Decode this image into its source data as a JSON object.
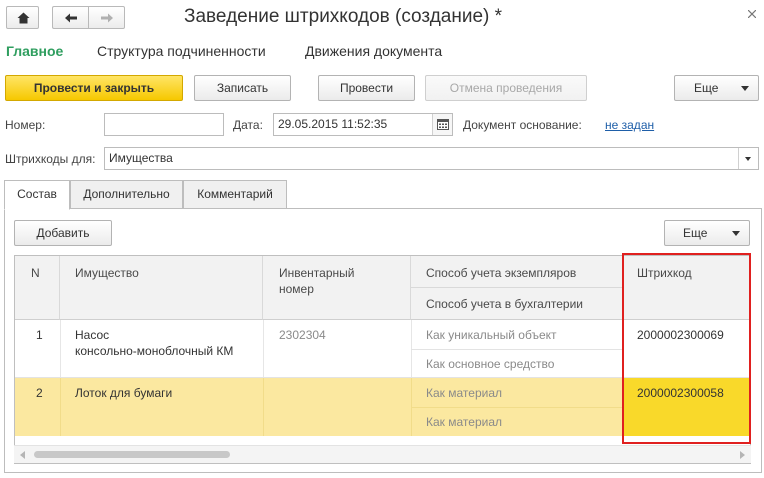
{
  "window": {
    "title": "Заведение штрихкодов (создание) *"
  },
  "nav": {
    "home_icon": "home-icon",
    "back_icon": "arrow-left-icon",
    "forward_icon": "arrow-right-icon"
  },
  "sections": {
    "main": "Главное",
    "structure": "Структура подчиненности",
    "movements": "Движения документа"
  },
  "toolbar": {
    "post_close": "Провести и закрыть",
    "save": "Записать",
    "post": "Провести",
    "unpost": "Отмена проведения",
    "more": "Еще"
  },
  "form": {
    "number_label": "Номер:",
    "number_value": "",
    "date_label": "Дата:",
    "date_value": "29.05.2015 11:52:35",
    "basis_label": "Документ основание:",
    "basis_link": "не задан",
    "barcodes_for_label": "Штрихкоды для:",
    "barcodes_for_value": "Имущества"
  },
  "tabs": {
    "composition": "Состав",
    "additional": "Дополнительно",
    "comment": "Комментарий"
  },
  "table_toolbar": {
    "add": "Добавить",
    "more": "Еще"
  },
  "table": {
    "headers": {
      "n": "N",
      "property": "Имущество",
      "inventory_line1": "Инвентарный",
      "inventory_line2": "номер",
      "instance_method": "Способ учета экземпляров",
      "accounting_method": "Способ учета в бухгалтерии",
      "barcode": "Штрихкод"
    },
    "rows": [
      {
        "n": "1",
        "property_line1": "Насос",
        "property_line2": "консольно-моноблочный КМ",
        "inventory": "2302304",
        "instance_method": "Как уникальный объект",
        "accounting_method": "Как основное средство",
        "barcode": "2000002300069"
      },
      {
        "n": "2",
        "property_line1": "Лоток для бумаги",
        "inventory": "",
        "instance_method": "Как материал",
        "accounting_method": "Как материал",
        "barcode": "2000002300058"
      }
    ]
  },
  "colors": {
    "accent_green": "#2f9e5f",
    "primary_button": "#f6c800",
    "selected_row": "#fbe8a0",
    "selected_cell": "#f9d92a",
    "highlight_outline": "#e0201f",
    "link": "#1e5ea8"
  }
}
